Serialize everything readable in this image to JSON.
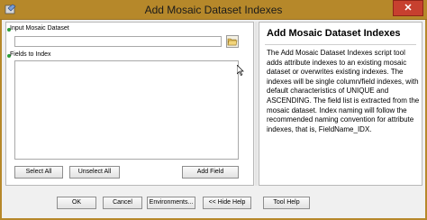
{
  "window": {
    "title": "Add Mosaic Dataset Indexes",
    "close_symbol": "✕"
  },
  "params": {
    "input_label": "Input Mosaic Dataset",
    "input_value": "",
    "fields_label": "Fields to Index"
  },
  "list_buttons": {
    "select_all": "Select All",
    "unselect_all": "Unselect All",
    "add_field": "Add Field"
  },
  "help": {
    "title": "Add Mosaic Dataset Indexes",
    "body": "The  Add  Mosaic Dataset Indexes script tool adds attribute indexes to an existing mosaic dataset or overwrites existing indexes. The indexes will be single column/field indexes, with default characteristics of UNIQUE and ASCENDING. The field list is extracted from the mosaic dataset. Index naming will follow the recommended naming convention for attribute indexes, that is, FieldName_IDX."
  },
  "footer": {
    "ok": "OK",
    "cancel": "Cancel",
    "environments": "Environments...",
    "hide_help": "<< Hide Help",
    "tool_help": "Tool Help"
  },
  "colors": {
    "title_bar": "#b6882a",
    "close_button": "#c7402f",
    "required_dot": "#2f9e3c"
  }
}
